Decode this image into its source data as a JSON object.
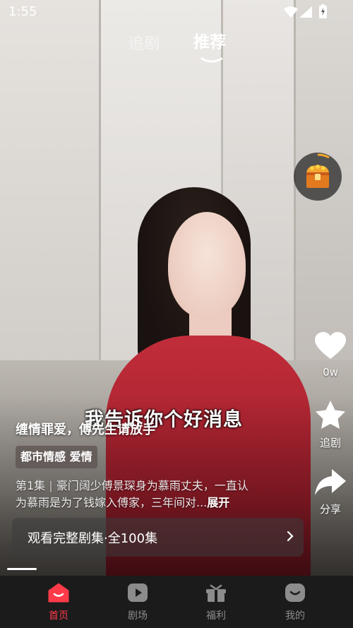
{
  "status_bar": {
    "time": "1:55"
  },
  "top_tabs": [
    {
      "label": "追剧",
      "active": false
    },
    {
      "label": "推荐",
      "active": true
    }
  ],
  "video": {
    "subtitle": "我告诉你个好消息",
    "drama_title": "缠情罪爱，傅先生请放手",
    "tags": "都市情感 爱情",
    "episode": "第1集",
    "separator": "|",
    "description": "豪门阔少傅景琛身为慕雨丈夫，一直认为慕雨是为了钱嫁入傅家，三年间对...",
    "expand_label": "展开",
    "watch_full_label": "观看完整剧集·全100集",
    "progress": 0.09
  },
  "side_actions": {
    "like_count": "0w",
    "follow_label": "追剧",
    "share_label": "分享"
  },
  "bottom_nav": [
    {
      "label": "首页",
      "icon": "home-icon",
      "active": true
    },
    {
      "label": "剧场",
      "icon": "theater-icon",
      "active": false
    },
    {
      "label": "福利",
      "icon": "gift-icon",
      "active": false
    },
    {
      "label": "我的",
      "icon": "profile-icon",
      "active": false
    }
  ],
  "colors": {
    "accent": "#ff3b4a",
    "nav_bg": "#1b1b1b",
    "treasure_gold": "#f2a531"
  }
}
